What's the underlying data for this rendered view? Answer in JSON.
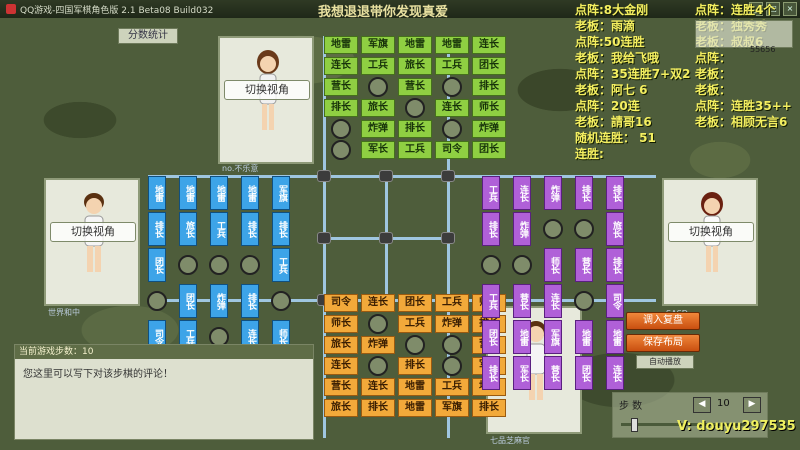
{
  "window": {
    "title": "QQ游戏-四国军棋角色版 2.1 Beta08 Build032",
    "banner": "我想退退带你发现真爱"
  },
  "stats_button": "分数统计",
  "players": {
    "top": {
      "view_label": "切换视角",
      "name": "no.不乐意"
    },
    "left": {
      "view_label": "切换视角",
      "name": "世界和中"
    },
    "right": {
      "view_label": "切换视角",
      "name": "SASD"
    },
    "bottom": {
      "name": "七品芝麻官"
    }
  },
  "pieces": {
    "top": [
      [
        "地雷",
        "军旗",
        "地雷",
        "地雷",
        "连长"
      ],
      [
        "连长",
        "工兵",
        "旅长",
        "工兵",
        "团长"
      ],
      [
        "营长",
        "",
        "营长",
        "",
        "排长"
      ],
      [
        "排长",
        "旅长",
        "",
        "连长",
        "师长"
      ],
      [
        "",
        "炸弹",
        "排长",
        "",
        "炸弹"
      ],
      [
        "",
        "军长",
        "工兵",
        "司令",
        "团长"
      ]
    ],
    "bottom": [
      [
        "司令",
        "连长",
        "团长",
        "工兵",
        "师长"
      ],
      [
        "师长",
        "",
        "工兵",
        "炸弹",
        "排长"
      ],
      [
        "旅长",
        "炸弹",
        "",
        "",
        "营长"
      ],
      [
        "连长",
        "",
        "排长",
        "",
        "军长"
      ],
      [
        "营长",
        "连长",
        "地雷",
        "工兵",
        "地雷"
      ],
      [
        "旅长",
        "排长",
        "地雷",
        "军旗",
        "排长"
      ]
    ],
    "left": [
      [
        "地雷",
        "排长",
        "团长",
        "",
        "司令",
        "军长"
      ],
      [
        "地雷",
        "旅长",
        "",
        "团长",
        "工兵",
        "营长"
      ],
      [
        "地雷",
        "工兵",
        "",
        "炸弹",
        "",
        "营长"
      ],
      [
        "地雷",
        "排长",
        "",
        "排长",
        "连长",
        "排长"
      ],
      [
        "军旗",
        "排长",
        "工兵",
        "",
        "师长",
        "连长"
      ]
    ],
    "right": [
      [
        "工兵",
        "排长",
        "",
        "工兵",
        "团长",
        "排长"
      ],
      [
        "连长",
        "炸弹",
        "",
        "营长",
        "地雷",
        "军长"
      ],
      [
        "炸弹",
        "",
        "师长",
        "连长",
        "军旗",
        "营长"
      ],
      [
        "排长",
        "",
        "营长",
        "",
        "地雷",
        "团长"
      ],
      [
        "排长",
        "旅长",
        "排长",
        "司令",
        "地雷",
        "连长"
      ]
    ]
  },
  "overlay_left": [
    "点阵:8大金刚",
    "老板：雨滴",
    "点阵:50连胜",
    "老板：我给飞哦",
    "点阵：35连胜7+双2",
    "老板：阿七 6",
    "点阵：20连",
    "老板：請哥16",
    "随机连胜： 51",
    "连胜:"
  ],
  "overlay_right": [
    "点阵：连胜4个",
    "老板：独秀秀",
    "老板：叔叔6",
    "点阵：",
    "老板：",
    "老板：",
    "点阵：连胜35++",
    "老板：相顾无言6"
  ],
  "top_right_box": "55656",
  "comment": {
    "header": "当前游戏步数：10",
    "body": "您这里可以写下对该步棋的评论！"
  },
  "buttons": {
    "load": "调入复盘",
    "save": "保存布局",
    "small": "自动播放"
  },
  "steps": {
    "label": "步  数",
    "value": "10",
    "prev": "◀",
    "next": "▶"
  },
  "watermark": "V:  douyu297535"
}
